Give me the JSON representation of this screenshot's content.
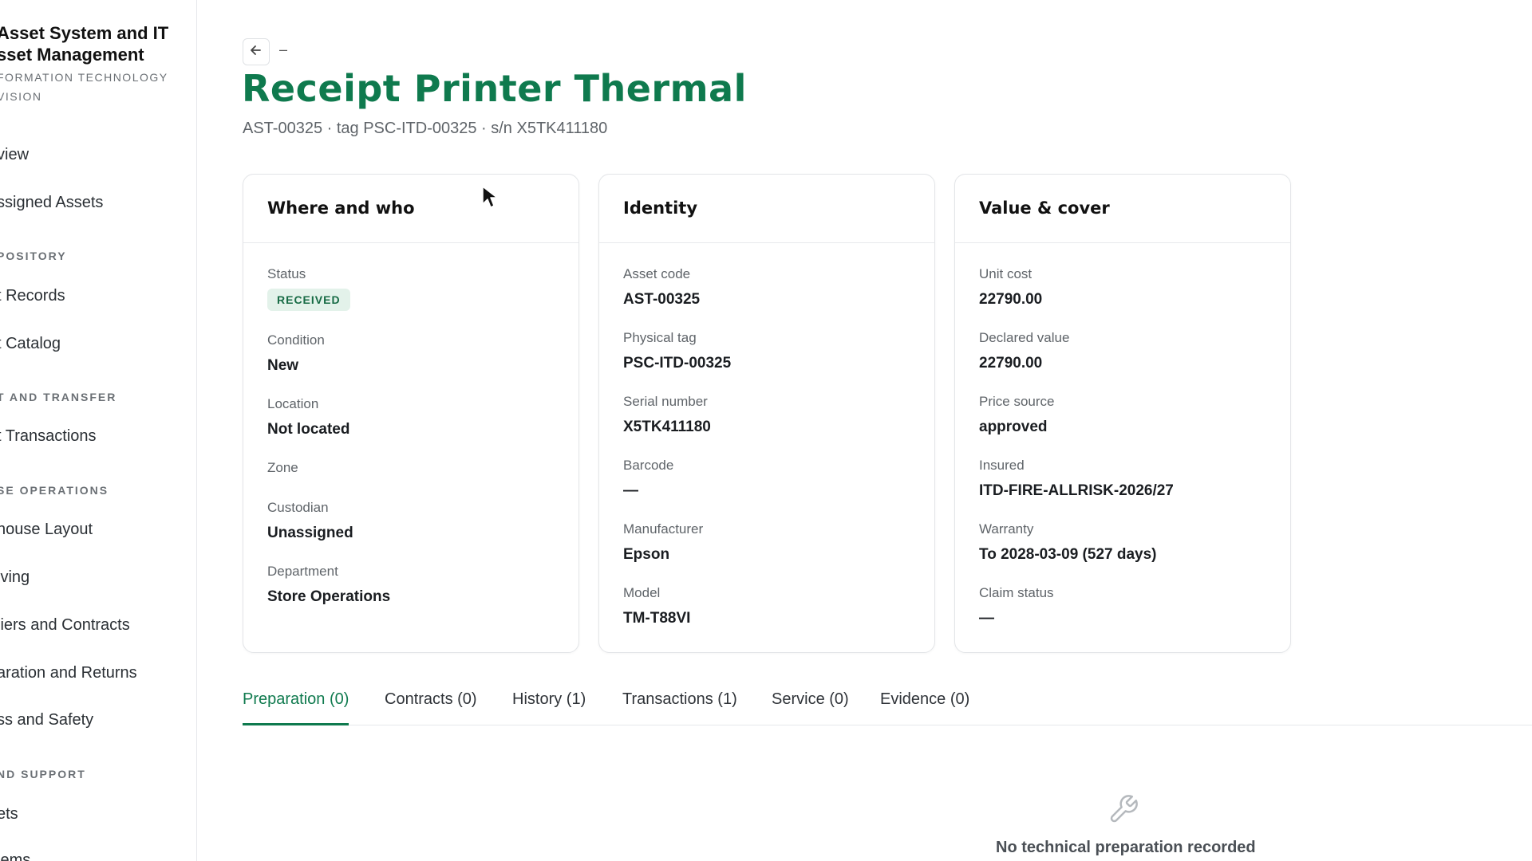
{
  "sidebar": {
    "brand_title_1": "Asset System and IT",
    "brand_title_2": "sset Management",
    "brand_sub_1": "FORMATION TECHNOLOGY",
    "brand_sub_2": "VISION",
    "items": [
      {
        "label": "view"
      },
      {
        "label": "ssigned Assets"
      },
      {
        "label": "t Records"
      },
      {
        "label": "t Catalog"
      },
      {
        "label": "t Transactions"
      },
      {
        "label": "house Layout"
      },
      {
        "label": "iving"
      },
      {
        "label": "liers and Contracts"
      },
      {
        "label": "aration and Returns"
      },
      {
        "label": "ss and Safety"
      },
      {
        "label": "ets"
      },
      {
        "label": "lems"
      }
    ],
    "sections": [
      "POSITORY",
      "T AND TRANSFER",
      "SE OPERATIONS",
      "ND SUPPORT"
    ]
  },
  "header": {
    "back_dash": "–",
    "title": "Receipt Printer Thermal",
    "subtitle": "AST-00325 · tag PSC-ITD-00325 · s/n X5TK411180"
  },
  "cards": {
    "where": {
      "title": "Where and who",
      "status_label": "Status",
      "status_value": "RECEIVED",
      "condition_label": "Condition",
      "condition_value": "New",
      "location_label": "Location",
      "location_value": "Not located",
      "zone_label": "Zone",
      "custodian_label": "Custodian",
      "custodian_value": "Unassigned",
      "department_label": "Department",
      "department_value": "Store Operations"
    },
    "identity": {
      "title": "Identity",
      "asset_code_label": "Asset code",
      "asset_code_value": "AST-00325",
      "tag_label": "Physical tag",
      "tag_value": "PSC-ITD-00325",
      "serial_label": "Serial number",
      "serial_value": "X5TK411180",
      "barcode_label": "Barcode",
      "barcode_value": "—",
      "manufacturer_label": "Manufacturer",
      "manufacturer_value": "Epson",
      "model_label": "Model",
      "model_value": "TM-T88VI"
    },
    "value": {
      "title": "Value & cover",
      "unit_cost_label": "Unit cost",
      "unit_cost_value": "22790.00",
      "declared_label": "Declared value",
      "declared_value": "22790.00",
      "price_source_label": "Price source",
      "price_source_value": "approved",
      "insured_label": "Insured",
      "insured_value": "ITD-FIRE-ALLRISK-2026/27",
      "warranty_label": "Warranty",
      "warranty_value": "To 2028-03-09 (527 days)",
      "claim_label": "Claim status",
      "claim_value": "—"
    }
  },
  "tabs": [
    {
      "label": "Preparation (0)"
    },
    {
      "label": "Contracts (0)"
    },
    {
      "label": "History (1)"
    },
    {
      "label": "Transactions (1)"
    },
    {
      "label": "Service (0)"
    },
    {
      "label": "Evidence (0)"
    }
  ],
  "empty_state": {
    "icon": "wrench-icon",
    "text": "No technical preparation recorded"
  },
  "colors": {
    "accent": "#0f7a4e",
    "badge_bg": "#e3f2ea"
  }
}
